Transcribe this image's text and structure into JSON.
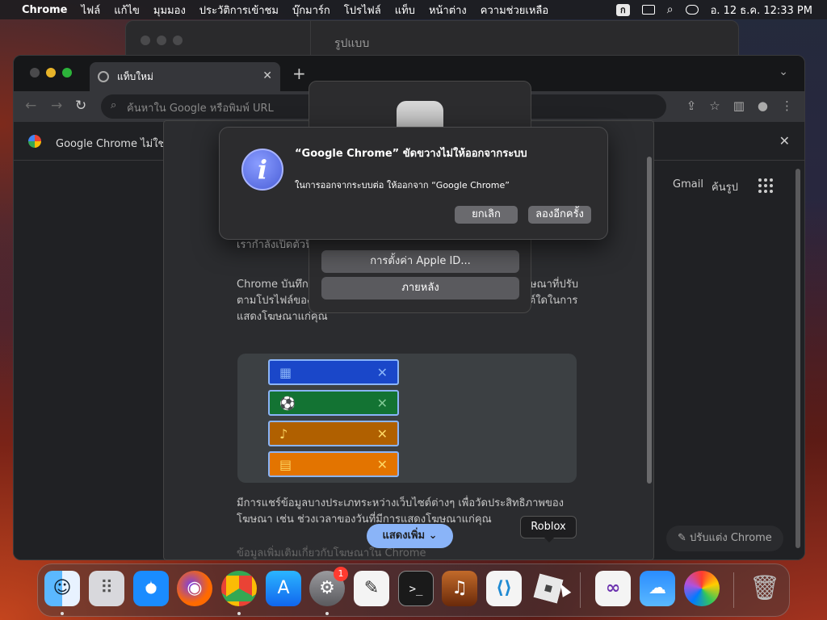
{
  "menubar": {
    "apple_icon": "apple-logo-icon",
    "app_name": "Chrome",
    "items": [
      "ไฟล์",
      "แก้ไข",
      "มุมมอง",
      "ประวัติการเข้าชม",
      "บุ๊กมาร์ก",
      "โปรไฟล์",
      "แท็บ",
      "หน้าต่าง",
      "ความช่วยเหลือ"
    ],
    "input_indicator": "ก",
    "datetime": "อ. 12 ธ.ค.  12:33 PM"
  },
  "background_window": {
    "title": "รูปแบบ"
  },
  "chrome": {
    "tab_title": "แท็บใหม่",
    "new_tab": "+",
    "omnibox_placeholder": "ค้นหาใน Google หรือพิมพ์ URL",
    "infobar_text": "Google Chrome ไม่ใช่เ",
    "gmail": "Gmail",
    "images": "ค้นรูป",
    "customize": "ปรับแต่ง Chrome"
  },
  "ads_dialog": {
    "para1": "เรากำลังเปิดตัวฟี                                                          เลือกมาก ขึ้นเกี่ยวกับโฆษณ",
    "para2": "Chrome บันทึกห                                                          สุด เว็บไซต์ที่คุณเข้า                                                          นี้ในภาย หลังเพื่อแสดงโฆษณาที่ปรับตามโปรไฟล์ของผู้ใช้ โดยคุณเลือกได้ว่าจะให้ใช้ หัวข้อหรือเว็บไซต์ใดในการแสดงโฆษณาแก่คุณ",
    "para3": "มีการแชร์ข้อมูลบางประเภทระหว่างเว็บไซต์ต่างๆ เพื่อวัดประสิทธิภาพของ โฆษณา เช่น ช่วงเวลาของวันที่มีการแสดงโฆษณาแก่คุณ",
    "show_more": "แสดงเพิ่ม",
    "faded_text": "ข้อมูลเพิ่มเติมเกี่ยวกับโฆษณาใน Chrome",
    "bands": [
      {
        "icon": "calendar-icon",
        "close": "✕",
        "color": "#1a47c9",
        "icon_color": "#8ab4f8"
      },
      {
        "icon": "soccer-ball-icon",
        "close": "✕",
        "color": "#137333",
        "icon_color": "#81c995"
      },
      {
        "icon": "music-note-icon",
        "close": "✕",
        "color": "#b06000",
        "icon_color": "#fdd663"
      },
      {
        "icon": "clapperboard-icon",
        "close": "✕",
        "color": "#c26401",
        "icon_color": "#fdd663"
      }
    ]
  },
  "system_dialog": {
    "btn_appleid": "การตั้งค่า Apple ID...",
    "btn_later": "ภายหลัง"
  },
  "alert": {
    "title": "“Google Chrome” ขัดขวางไม่ให้ออกจากระบบ",
    "message": "ในการออกจากระบบต่อ ให้ออกจาก “Google Chrome”",
    "cancel": "ยกเลิก",
    "retry": "ลองอีกครั้ง"
  },
  "dock": {
    "tooltip": "Roblox",
    "settings_badge": "1",
    "items": [
      "finder-icon",
      "launchpad-icon",
      "safari-icon",
      "firefox-icon",
      "chrome-icon",
      "app-store-icon",
      "system-settings-icon",
      "textedit-icon",
      "terminal-icon",
      "garageband-icon",
      "vscode-icon",
      "roblox-icon",
      "visual-studio-icon",
      "weather-icon",
      "color-picker-icon",
      "trash-icon"
    ]
  }
}
